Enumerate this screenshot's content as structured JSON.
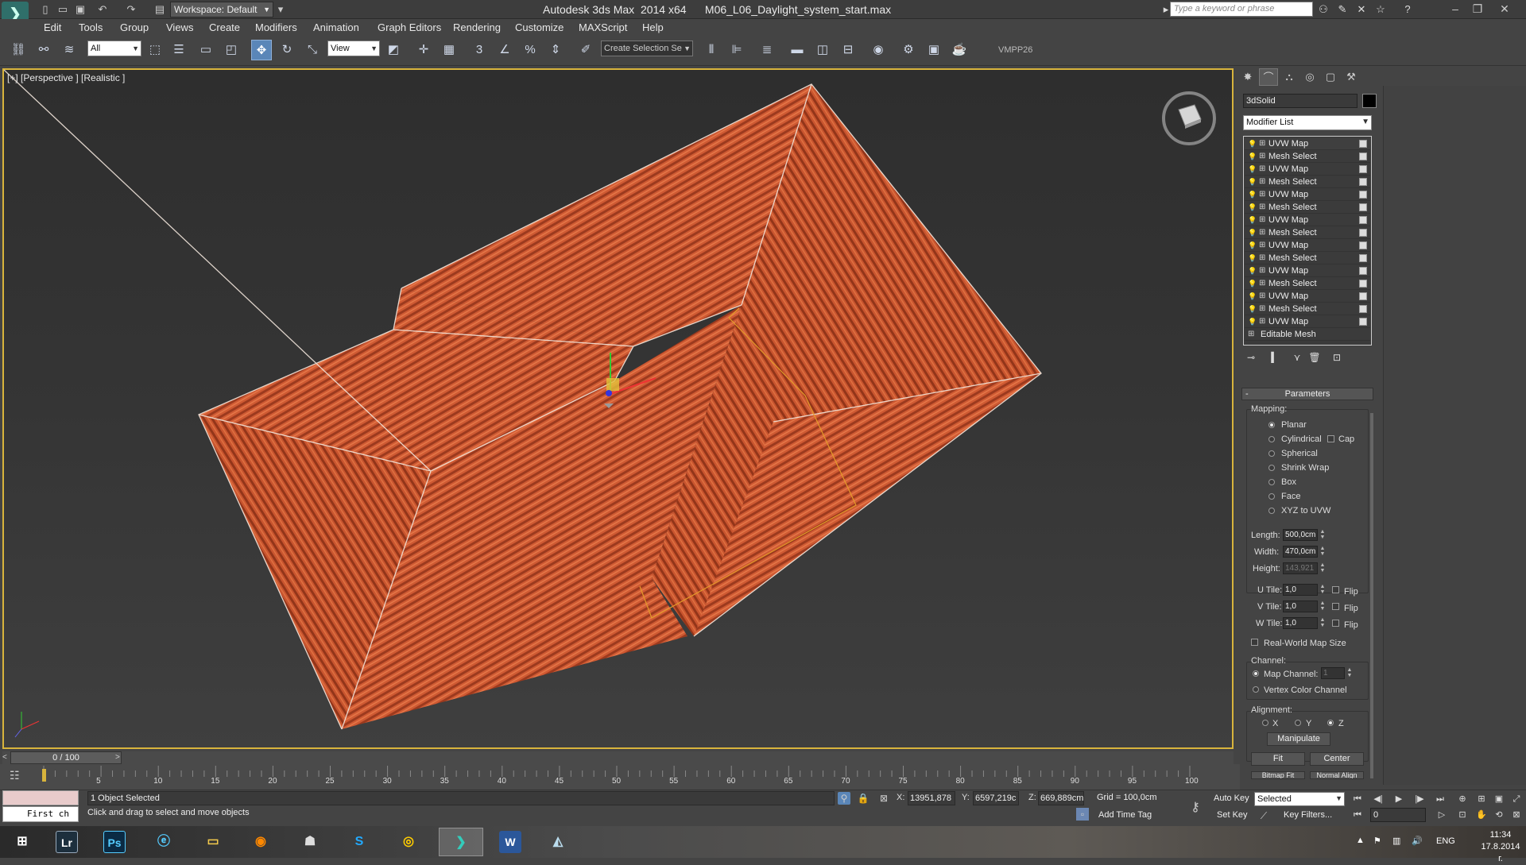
{
  "titlebar": {
    "workspace": "Workspace: Default",
    "app_title": "Autodesk 3ds Max  2014 x64",
    "file_title": "M06_L06_Daylight_system_start.max",
    "search_placeholder": "Type a keyword or phrase"
  },
  "menu": [
    "Edit",
    "Tools",
    "Group",
    "Views",
    "Create",
    "Modifiers",
    "Animation",
    "Graph Editors",
    "Rendering",
    "Customize",
    "MAXScript",
    "Help"
  ],
  "toolbar": {
    "selection_filter": "All",
    "ref_coord": "View",
    "selection_set": "Create Selection Se",
    "vmpp_label": "VMPP26",
    "snap_labels": [
      "3",
      "%"
    ]
  },
  "viewport": {
    "label": "[+] [Perspective ] [Realistic ]",
    "accent": "#d8b43c",
    "roof_color": "#c8502c"
  },
  "command_panel": {
    "object_name": "3dSolid",
    "modifier_list": "Modifier List",
    "stack": [
      "UVW Map",
      "Mesh Select",
      "UVW Map",
      "Mesh Select",
      "UVW Map",
      "Mesh Select",
      "UVW Map",
      "Mesh Select",
      "UVW Map",
      "Mesh Select",
      "UVW Map",
      "Mesh Select",
      "UVW Map",
      "Mesh Select",
      "UVW Map"
    ],
    "stack_base": "Editable Mesh",
    "rollout_title": "Parameters",
    "mapping": {
      "label": "Mapping:",
      "options": [
        "Planar",
        "Cylindrical",
        "Spherical",
        "Shrink Wrap",
        "Box",
        "Face",
        "XYZ to UVW"
      ],
      "selected": "Planar",
      "cap_label": "Cap"
    },
    "length_label": "Length:",
    "length": "500,0cm",
    "width_label": "Width:",
    "width": "470,0cm",
    "height_label": "Height:",
    "height": "143,921",
    "utile_label": "U Tile:",
    "utile": "1,0",
    "vtile_label": "V Tile:",
    "vtile": "1,0",
    "wtile_label": "W Tile:",
    "wtile": "1,0",
    "flip_label": "Flip",
    "realworld_label": "Real-World Map Size",
    "channel_label": "Channel:",
    "map_channel_label": "Map Channel:",
    "map_channel": "1",
    "vertex_color_label": "Vertex Color Channel",
    "alignment_label": "Alignment:",
    "axes": [
      "X",
      "Y",
      "Z"
    ],
    "axis_selected": "Z",
    "manipulate_label": "Manipulate",
    "fit_label": "Fit",
    "center_label": "Center",
    "bitmap_fit_label": "Bitmap Fit",
    "normal_align_label": "Normal Align"
  },
  "timeline": {
    "frame_display": "0 / 100",
    "ticks": [
      "5",
      "10",
      "15",
      "20",
      "25",
      "30",
      "35",
      "40",
      "45",
      "50",
      "55",
      "60",
      "65",
      "70",
      "75",
      "80",
      "85",
      "90",
      "95",
      "100"
    ]
  },
  "status": {
    "maxscript_text": "First ch",
    "selection_count": "1 Object Selected",
    "prompt": "Click and drag to select and move objects",
    "x_label": "X:",
    "x": "13951,878",
    "y_label": "Y:",
    "y": "6597,219c",
    "z_label": "Z:",
    "z": "669,889cm",
    "grid": "Grid = 100,0cm",
    "add_time_tag": "Add Time Tag",
    "auto_key": "Auto Key",
    "set_key": "Set Key",
    "key_mode": "Selected",
    "key_filters": "Key Filters...",
    "current_frame": "0"
  },
  "taskbar": {
    "apps": [
      "Lr",
      "Ps"
    ],
    "language": "ENG",
    "time": "11:34",
    "date": "17.8.2014 г."
  }
}
